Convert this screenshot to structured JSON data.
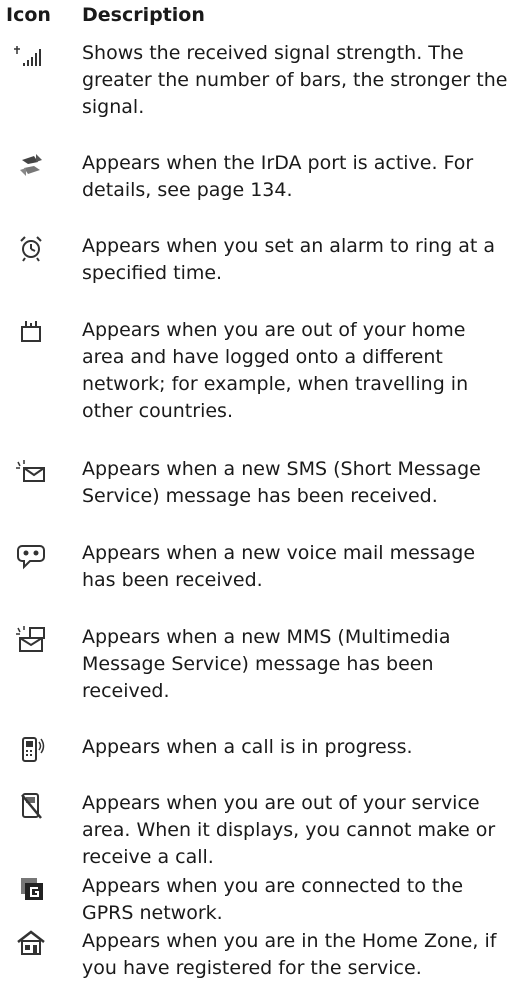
{
  "header": {
    "icon_col": "Icon",
    "desc_col": "Description"
  },
  "rows": [
    {
      "icon": "signal-strength-icon",
      "text": "Shows the received signal strength. The greater the number of bars, the stronger the signal."
    },
    {
      "icon": "irda-icon",
      "text": "Appears when the IrDA port is active. For details, see page 134."
    },
    {
      "icon": "alarm-clock-icon",
      "text": "Appears when you set an alarm to ring at a specified time."
    },
    {
      "icon": "roaming-icon",
      "text": "Appears when you are out of your home area and have logged onto a different network; for example, when travelling in other countries."
    },
    {
      "icon": "new-sms-icon",
      "text": "Appears when a new SMS (Short Message Service) message has been received."
    },
    {
      "icon": "voice-mail-icon",
      "text": "Appears when a new voice mail message has been received."
    },
    {
      "icon": "new-mms-icon",
      "text": "Appears when a new MMS (Multimedia Message Service) message has been received."
    },
    {
      "icon": "call-in-progress-icon",
      "text": "Appears when a call is in progress."
    },
    {
      "icon": "no-service-icon",
      "text": "Appears when you are out of your service area. When it displays, you cannot make or receive a call."
    },
    {
      "icon": "gprs-icon",
      "text": "Appears when you are connected to the GPRS network."
    },
    {
      "icon": "home-zone-icon",
      "text": "Appears when you are in the Home Zone, if you have registered for the service."
    }
  ]
}
